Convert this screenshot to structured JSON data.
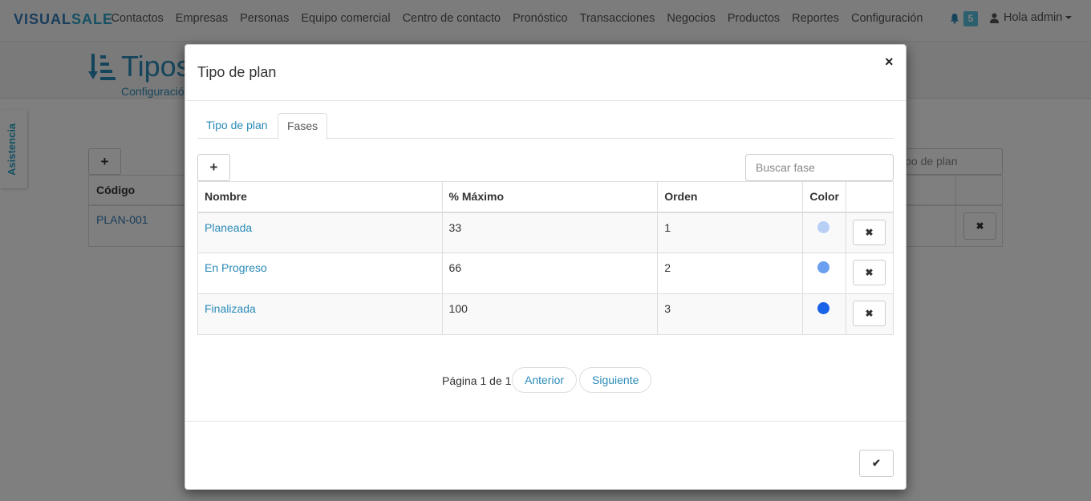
{
  "navbar": {
    "brand_visual": "VISUAL",
    "brand_sale": "SALE",
    "links": [
      "Contactos",
      "Empresas",
      "Personas",
      "Equipo comercial",
      "Centro de contacto",
      "Pronóstico",
      "Transacciones",
      "Negocios",
      "Productos",
      "Reportes",
      "Configuración"
    ],
    "notifications_count": "5",
    "user_label": "Hola admin"
  },
  "page": {
    "title": "Tipos",
    "breadcrumb": "Configuració",
    "assist_label": "Asistencia",
    "add_label": "+",
    "search_placeholder": "ipo de plan",
    "table_header": "Código",
    "table_row_code": "PLAN-001",
    "delete_label": "✖"
  },
  "modal": {
    "title": "Tipo de plan",
    "close_label": "×",
    "tabs": [
      "Tipo de plan",
      "Fases"
    ],
    "active_tab": "Fases",
    "add_label": "+",
    "search_placeholder": "Buscar fase",
    "columns": [
      "Nombre",
      "% Máximo",
      "Orden",
      "Color",
      ""
    ],
    "rows": [
      {
        "name": "Planeada",
        "max": "33",
        "order": "1",
        "color": "#b8d0f5"
      },
      {
        "name": "En Progreso",
        "max": "66",
        "order": "2",
        "color": "#6b9ff0"
      },
      {
        "name": "Finalizada",
        "max": "100",
        "order": "3",
        "color": "#1a62e8"
      }
    ],
    "delete_label": "✖",
    "pagination": {
      "label": "Página 1 de 1",
      "prev": "Anterior",
      "next": "Siguiente"
    },
    "confirm_label": "✔"
  }
}
